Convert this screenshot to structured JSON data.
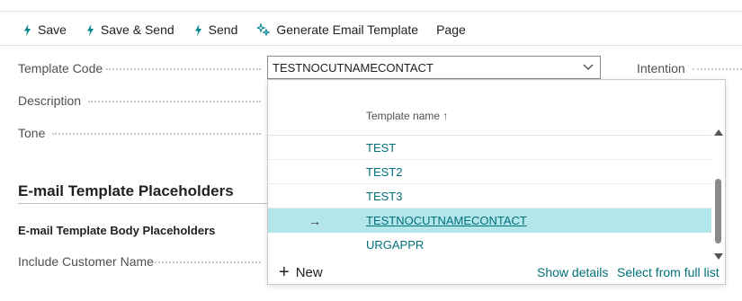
{
  "toolbar": {
    "actions": [
      {
        "label": "Save",
        "icon": "lightning-icon"
      },
      {
        "label": "Save & Send",
        "icon": "lightning-icon"
      },
      {
        "label": "Send",
        "icon": "lightning-icon"
      },
      {
        "label": "Generate Email Template",
        "icon": "sparkle-icon"
      },
      {
        "label": "Page",
        "icon": ""
      }
    ]
  },
  "form": {
    "template_code_label": "Template Code",
    "template_code_value": "TESTNOCUTNAMECONTACT",
    "intention_label": "Intention",
    "description_label": "Description",
    "tone_label": "Tone",
    "section_title": "E-mail Template Placeholders",
    "body_placeholders_title": "E-mail Template Body Placeholders",
    "include_customer_name_label": "Include Customer Name"
  },
  "dropdown": {
    "column_header": "Template name ↑",
    "rows": [
      "TEST",
      "TEST2",
      "TEST3",
      "TESTNOCUTNAMECONTACT",
      "URGAPPR"
    ],
    "selected_index": 3,
    "selected_arrow": "→",
    "new_label": "New",
    "show_details_label": "Show details",
    "select_full_list_label": "Select from full list"
  },
  "colors": {
    "accent": "#008489",
    "link": "#00707a",
    "selected_row": "#b2e6ea"
  }
}
